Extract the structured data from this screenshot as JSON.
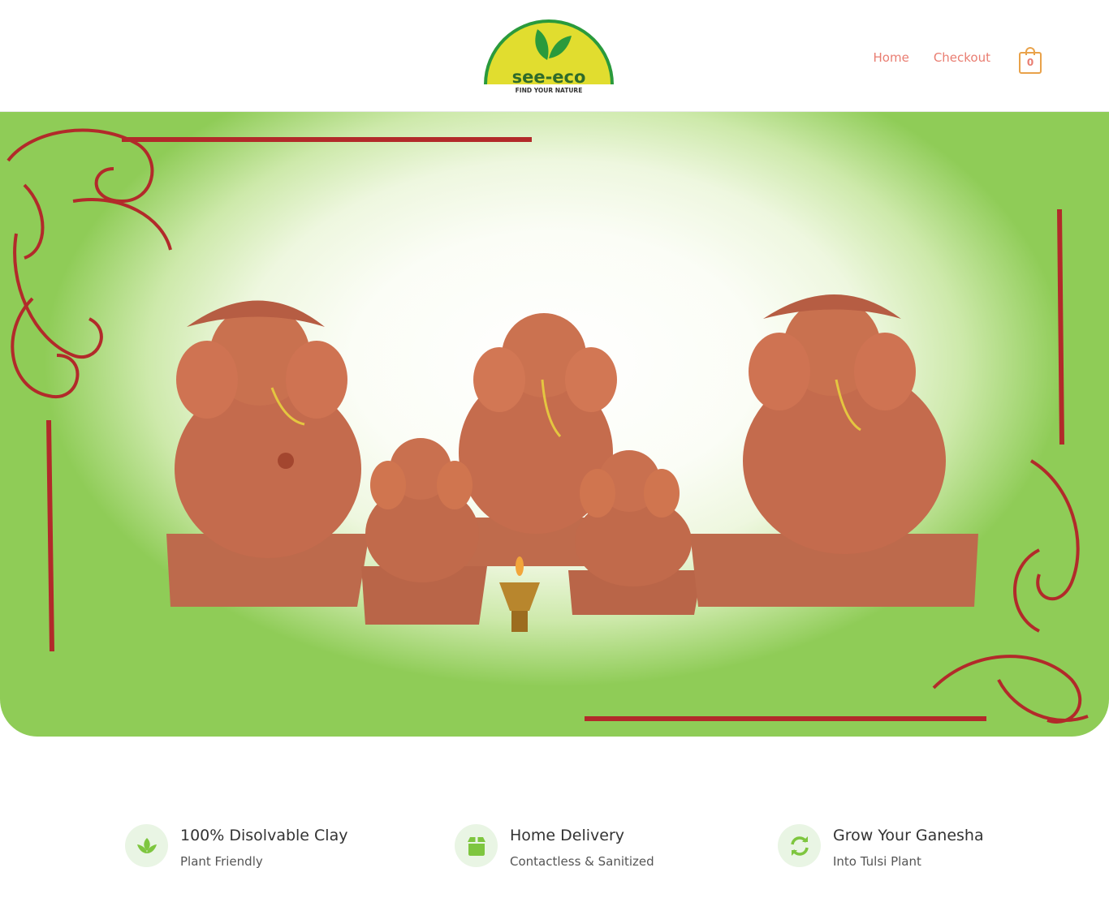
{
  "brand": {
    "name": "see-eco",
    "tagline": "FIND YOUR NATURE"
  },
  "nav": {
    "items": [
      {
        "label": "Home"
      },
      {
        "label": "Checkout"
      }
    ],
    "cart_count": "0"
  },
  "hero": {
    "image": "ganesha-clay-idols-banner"
  },
  "features": [
    {
      "icon": "leaf-icon",
      "title": "100% Disolvable Clay",
      "subtitle": "Plant Friendly"
    },
    {
      "icon": "box-icon",
      "title": "Home Delivery",
      "subtitle": "Contactless & Sanitized"
    },
    {
      "icon": "refresh-icon",
      "title": "Grow Your Ganesha",
      "subtitle": "Into Tulsi Plant"
    }
  ],
  "colors": {
    "accent": "#e97d71",
    "cart": "#e9a24a",
    "icon_green": "#7ec63f",
    "logo_yellow": "#e1dd2f",
    "logo_green": "#2a9a3c"
  }
}
